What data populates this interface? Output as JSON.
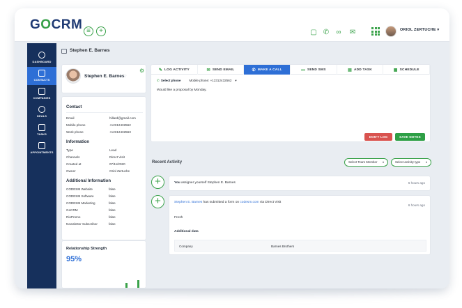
{
  "app": {
    "logo_go": "G",
    "logo_o": "O",
    "logo_crm": "CRM"
  },
  "topbar": {
    "user_name": "ORIOL ZERTUCHE ▾"
  },
  "sidebar": {
    "items": [
      {
        "label": "DASHBOARD",
        "icon": "dashboard-icon"
      },
      {
        "label": "CONTACTS",
        "icon": "contacts-icon"
      },
      {
        "label": "COMPANIES",
        "icon": "companies-icon"
      },
      {
        "label": "DEALS",
        "icon": "deals-icon"
      },
      {
        "label": "TASKS",
        "icon": "tasks-icon"
      },
      {
        "label": "APPOINTMENTS",
        "icon": "appointments-icon"
      }
    ],
    "active": "CONTACTS"
  },
  "breadcrumb": {
    "title": "Stephen E. Barnes"
  },
  "profile": {
    "name": "Stephen E. Barnes",
    "star": "☆"
  },
  "contact": {
    "title": "Contact",
    "rows": [
      {
        "k": "Email",
        "v": "hillard@gmail.com"
      },
      {
        "k": "Mobile phone",
        "v": "+12312432562"
      },
      {
        "k": "Work phone",
        "v": "+12312432563"
      }
    ]
  },
  "information": {
    "title": "Information",
    "rows": [
      {
        "k": "Type",
        "v": "Lead"
      },
      {
        "k": "Channels",
        "v": "Direct Visit"
      },
      {
        "k": "Created at",
        "v": "07/11/2020"
      },
      {
        "k": "Owner",
        "v": "Oriol Zertuche"
      }
    ]
  },
  "additional": {
    "title": "Additional Information",
    "rows": [
      {
        "k": "CODESM Website",
        "v": "false"
      },
      {
        "k": "CODESM Software",
        "v": "false"
      },
      {
        "k": "CODESM Marketing",
        "v": "false"
      },
      {
        "k": "GoCRM",
        "v": "false"
      },
      {
        "k": "RioPromo",
        "v": "false"
      },
      {
        "k": "Newsletter Subscriber",
        "v": "false"
      }
    ]
  },
  "strength": {
    "title": "Relationship Strength",
    "value": "95%"
  },
  "actions": {
    "tabs": [
      {
        "label": "LOG ACTIVITY",
        "icon": "✎"
      },
      {
        "label": "SEND EMAIL",
        "icon": "✉"
      },
      {
        "label": "MAKE A CALL",
        "icon": "✆"
      },
      {
        "label": "SEND SMS",
        "icon": "▭"
      },
      {
        "label": "ADD TASK",
        "icon": "▤"
      },
      {
        "label": "SCHEDULE",
        "icon": "▦"
      }
    ],
    "active_tab": "MAKE A CALL",
    "select_phone": "Select phone",
    "mobile_phone": "Mobile phone: +12312432562",
    "caret": "▾",
    "note": "Would like a proposal by Monday.",
    "dont_log": "DON'T LOG",
    "save_notes": "SAVE NOTES"
  },
  "recent": {
    "title": "Recent Activity",
    "filter_member": "Select Team Member",
    "filter_type": "Select activity type",
    "caret": "▾",
    "activities": [
      {
        "actor": "You",
        "text": " assigner yourself Stephen E. Barnes",
        "time": "6 hours ago"
      },
      {
        "actor": "Stephen E. Barnes",
        "text_mid": " has submitted a form on ",
        "site": "codesm.com",
        "text_end": " via Direct Visit",
        "time": "6 hours ago",
        "status": "Fresh",
        "additional_title": "Additional data",
        "company_label": "Company",
        "company_value": "Barnes Brothers"
      }
    ]
  },
  "colors": {
    "navy": "#16305c",
    "blue": "#2e6fd6",
    "green": "#3aa24a",
    "red": "#d9534f"
  },
  "strength_bars": [
    0.6,
    0.9
  ]
}
